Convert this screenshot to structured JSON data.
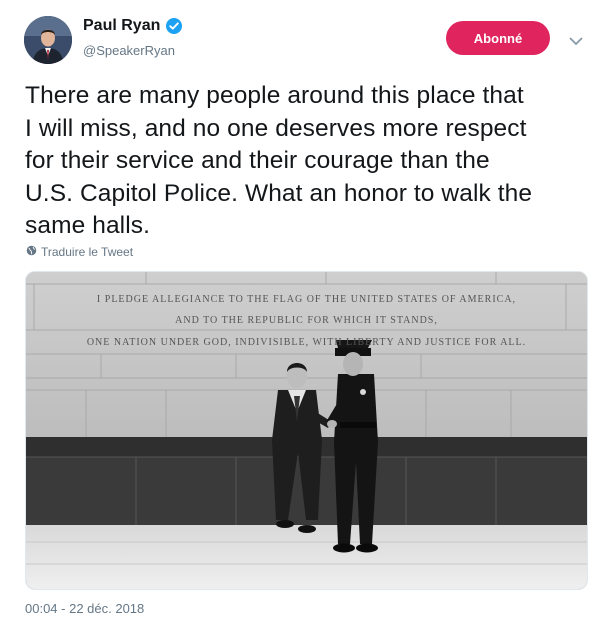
{
  "user": {
    "name": "Paul Ryan",
    "handle": "@SpeakerRyan",
    "verified": true
  },
  "follow_button": {
    "label": "Abonné",
    "color": "#e0245e"
  },
  "tweet": {
    "lines": [
      "There are many people around this place that",
      "I will miss, and no one deserves more respect",
      "for their service and their courage than the",
      "U.S. Capitol Police. What an honor to walk the",
      "same halls."
    ]
  },
  "translate_label": "Traduire le Tweet",
  "photo": {
    "inscription": [
      "I PLEDGE ALLEGIANCE TO THE FLAG OF THE UNITED STATES OF AMERICA,",
      "AND TO THE REPUBLIC FOR WHICH IT STANDS,",
      "ONE NATION UNDER GOD, INDIVISIBLE, WITH LIBERTY AND JUSTICE FOR ALL."
    ]
  },
  "timestamp": "00:04 - 22 déc. 2018",
  "icons": {
    "verified": "verified-badge-icon",
    "caret": "chevron-down-icon",
    "translate": "globe-icon"
  }
}
